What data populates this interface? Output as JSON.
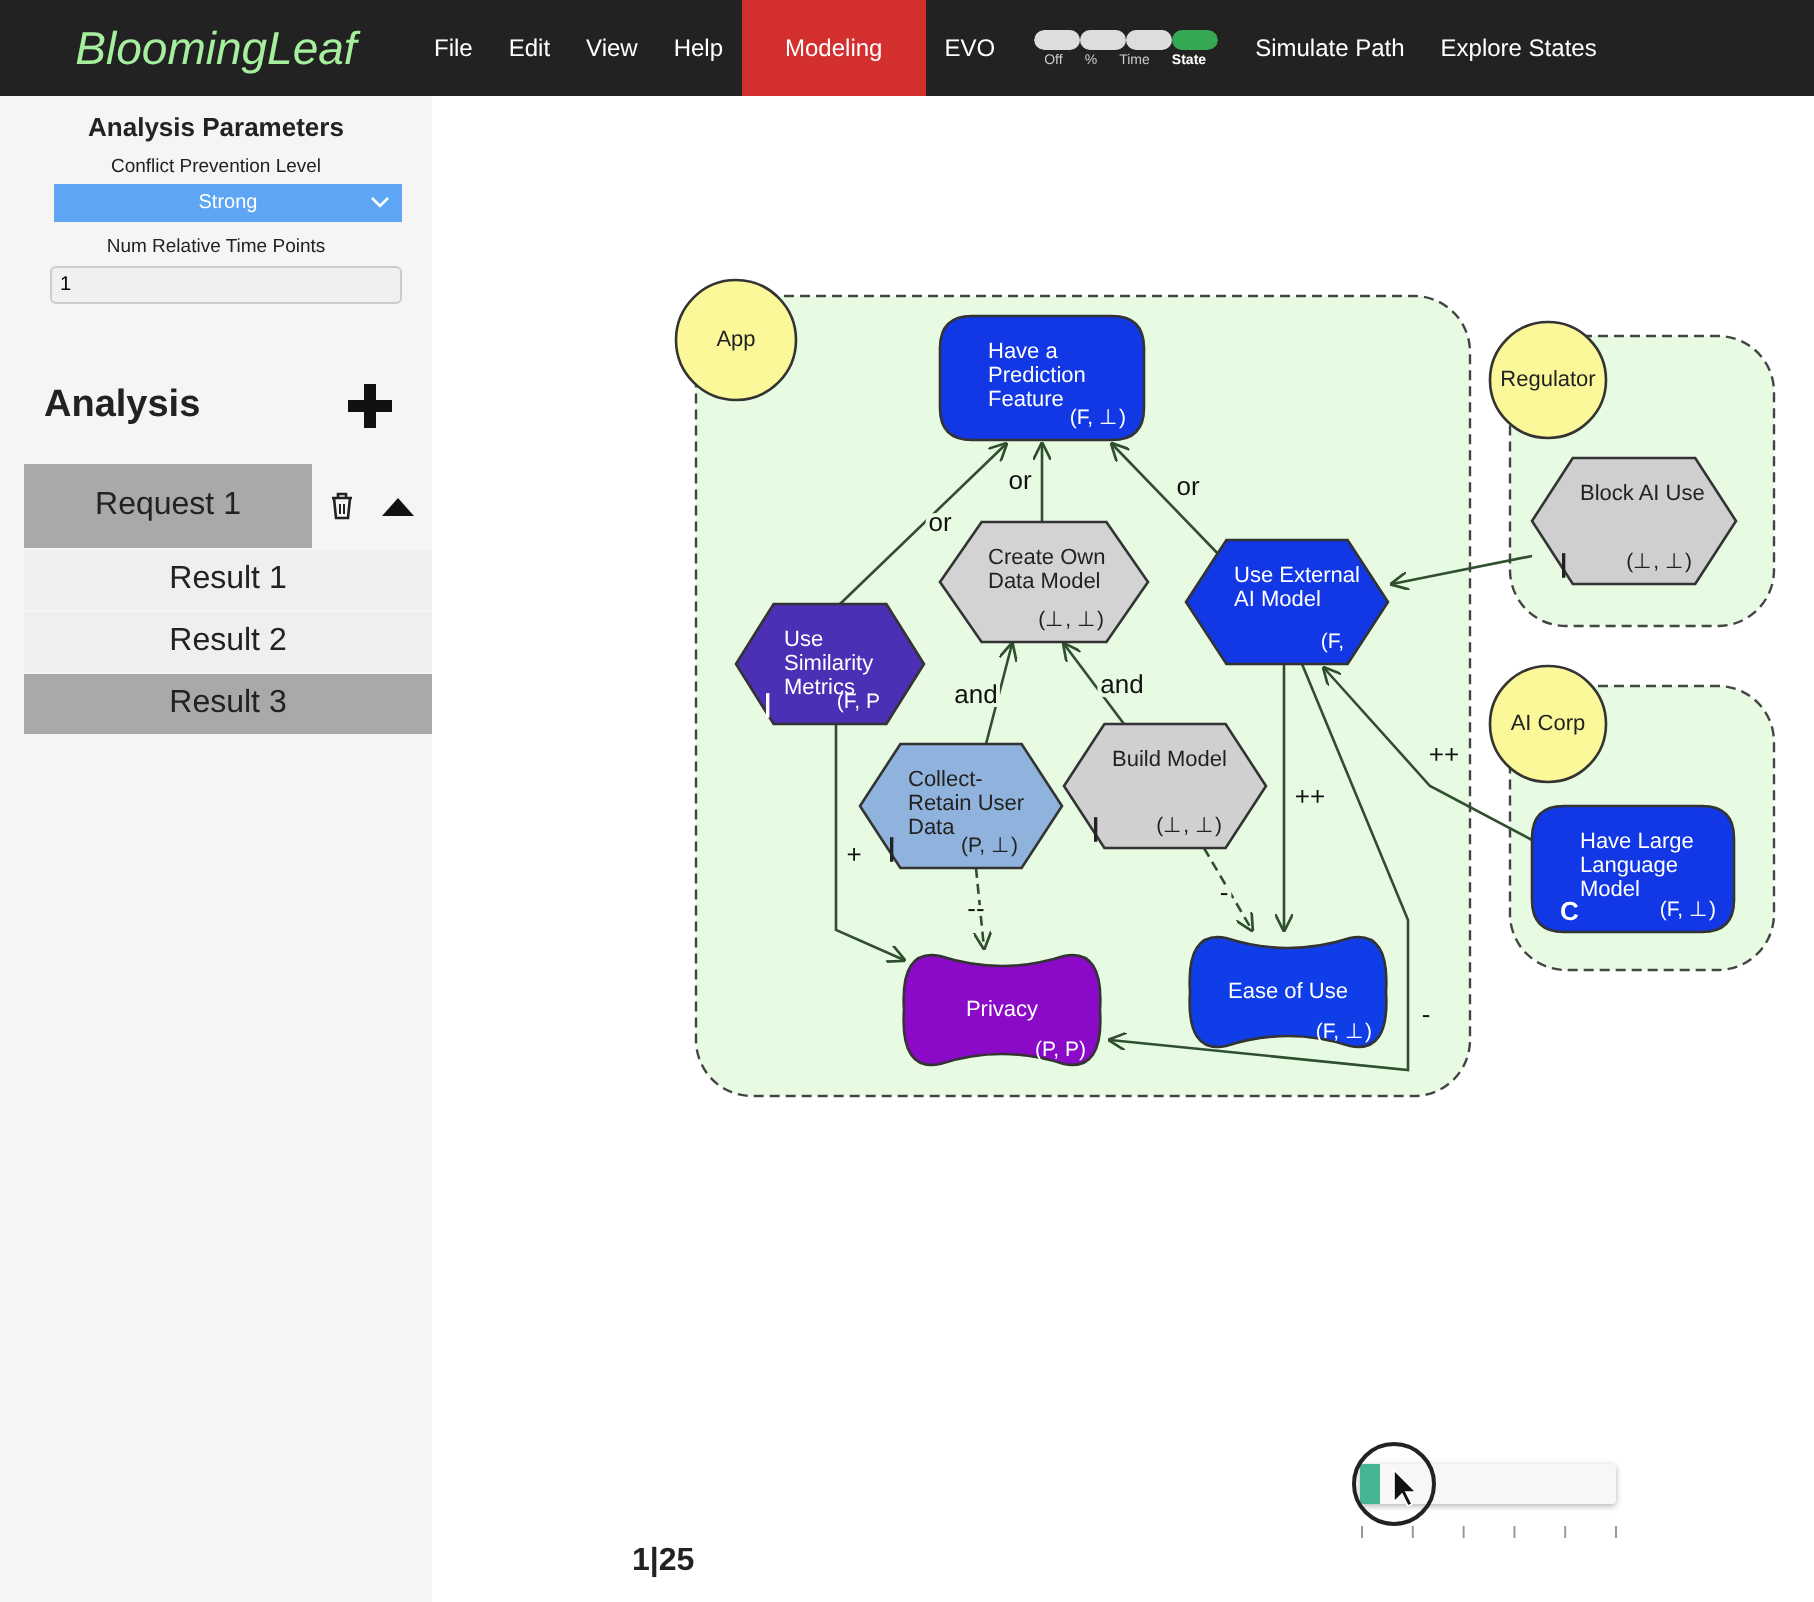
{
  "app": {
    "logo": "BloomingLeaf"
  },
  "menu": [
    {
      "label": "File",
      "selected": false
    },
    {
      "label": "Edit",
      "selected": false
    },
    {
      "label": "View",
      "selected": false
    },
    {
      "label": "Help",
      "selected": false
    },
    {
      "label": "Modeling",
      "selected": true
    },
    {
      "label": "EVO",
      "selected": false
    }
  ],
  "evo_toggle": {
    "options": [
      {
        "label": "Off",
        "selected": false
      },
      {
        "label": "%",
        "selected": false
      },
      {
        "label": "Time",
        "selected": false
      },
      {
        "label": "State",
        "selected": true
      }
    ]
  },
  "menu_right": [
    "Simulate Path",
    "Explore States"
  ],
  "sidebar": {
    "title": "Analysis Parameters",
    "conflict_label": "Conflict Prevention Level",
    "conflict_value": "Strong",
    "time_points_label": "Num Relative Time Points",
    "time_points_value": "1",
    "analysis_title": "Analysis",
    "requests": [
      {
        "name": "Request 1",
        "expanded": true,
        "results": [
          {
            "name": "Result 1",
            "selected": false
          },
          {
            "name": "Result 2",
            "selected": false
          },
          {
            "name": "Result 3",
            "selected": true
          }
        ]
      }
    ]
  },
  "diagram": {
    "actors": [
      {
        "name": "App"
      },
      {
        "name": "Regulator"
      },
      {
        "name": "AI Corp"
      }
    ],
    "nodes": [
      {
        "kind": "goal",
        "name": "Have a Prediction Feature",
        "state": "(F, ⊥)",
        "color": "#1238e6"
      },
      {
        "kind": "task",
        "name": "Create Own Data Model",
        "state": "(⊥, ⊥)",
        "color": "#d3d3d3"
      },
      {
        "kind": "task",
        "name": "Use External AI Model",
        "state": "(F,",
        "color": "#1238e6"
      },
      {
        "kind": "task",
        "name": "Use Similarity Metrics",
        "state": "(F, P",
        "marker": "|",
        "color": "#4b2fb5"
      },
      {
        "kind": "task",
        "name": "Collect-Retain User Data",
        "state": "(P, ⊥)",
        "marker": "|",
        "color": "#8fb3dc"
      },
      {
        "kind": "task",
        "name": "Build Model",
        "state": "(⊥, ⊥)",
        "marker": "|",
        "color": "#d0d0d0"
      },
      {
        "kind": "softgoal",
        "name": "Privacy",
        "state": "(P, P)",
        "color": "#8a0ac8"
      },
      {
        "kind": "softgoal",
        "name": "Ease of Use",
        "state": "(F, ⊥)",
        "color": "#0f3ee8"
      },
      {
        "kind": "task",
        "name": "Block AI Use",
        "state": "(⊥, ⊥)",
        "marker": "|",
        "color": "#cfcfcf"
      },
      {
        "kind": "goal",
        "name": "Have Large Language Model",
        "state": "(F, ⊥)",
        "marker": "C",
        "color": "#1238e6"
      }
    ],
    "links": [
      {
        "label": "or",
        "dashed": false
      },
      {
        "label": "or",
        "dashed": false
      },
      {
        "label": "or",
        "dashed": false
      },
      {
        "label": "and",
        "dashed": false
      },
      {
        "label": "and",
        "dashed": false
      },
      {
        "label": "+",
        "dashed": false
      },
      {
        "label": "--",
        "dashed": true
      },
      {
        "label": "-",
        "dashed": true
      },
      {
        "label": "++",
        "dashed": false
      },
      {
        "label": "-",
        "dashed": false
      },
      {
        "label": "++",
        "dashed": false
      },
      {
        "dashed": false
      }
    ]
  },
  "footer": {
    "step": "1|25",
    "slider": {
      "level": 0.08
    }
  }
}
